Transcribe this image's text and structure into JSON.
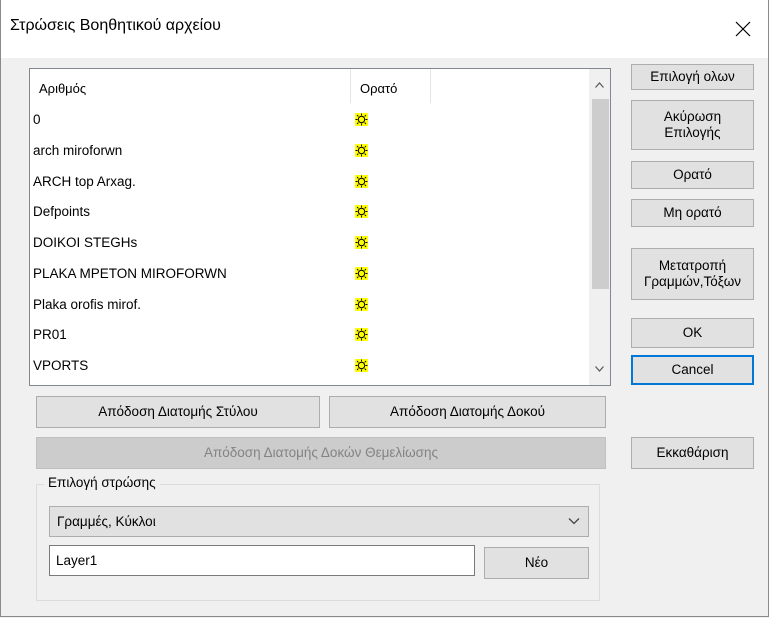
{
  "window": {
    "title": "Στρώσεις Βοηθητικού αρχείου",
    "close_icon": "close-icon"
  },
  "table": {
    "columns": [
      "Αριθμός",
      "Ορατό"
    ],
    "rows": [
      {
        "name": "0",
        "visible_icon": "visible-sun-icon"
      },
      {
        "name": "arch miroforwn",
        "visible_icon": "visible-sun-icon"
      },
      {
        "name": "ARCH top Arxag.",
        "visible_icon": "visible-sun-icon"
      },
      {
        "name": "Defpoints",
        "visible_icon": "visible-sun-icon"
      },
      {
        "name": "DOIKOI STEGHs",
        "visible_icon": "visible-sun-icon"
      },
      {
        "name": "PLAKA MPETON MIROFORWN",
        "visible_icon": "visible-sun-icon"
      },
      {
        "name": "Plaka orofis mirof.",
        "visible_icon": "visible-sun-icon"
      },
      {
        "name": "PR01",
        "visible_icon": "visible-sun-icon"
      },
      {
        "name": "VPORTS",
        "visible_icon": "visible-sun-icon"
      }
    ]
  },
  "buttons": {
    "select_all": "Επιλογή ολων",
    "cancel_selection_line1": "Ακύρωση",
    "cancel_selection_line2": "Επιλογής",
    "visible": "Ορατό",
    "not_visible": "Μη ορατό",
    "convert_line1": "Μετατροπή",
    "convert_line2": "Γραμμών,Τόξων",
    "ok": "OK",
    "cancel": "Cancel",
    "clear": "Εκκαθάριση",
    "assign_column_section": "Απόδοση Διατομής Στύλου",
    "assign_beam_section": "Απόδοση Διατομής Δοκού",
    "assign_foundation_beam_section": "Απόδοση Διατομής Δοκών Θεμελίωσης",
    "new": "Νέο"
  },
  "layer_selection": {
    "group_label": "Επιλογή στρώσης",
    "combo_value": "Γραμμές, Κύκλοι",
    "layer_name": "Layer1"
  },
  "colors": {
    "accent": "#0078d7",
    "visible_icon": "#ffff00"
  }
}
